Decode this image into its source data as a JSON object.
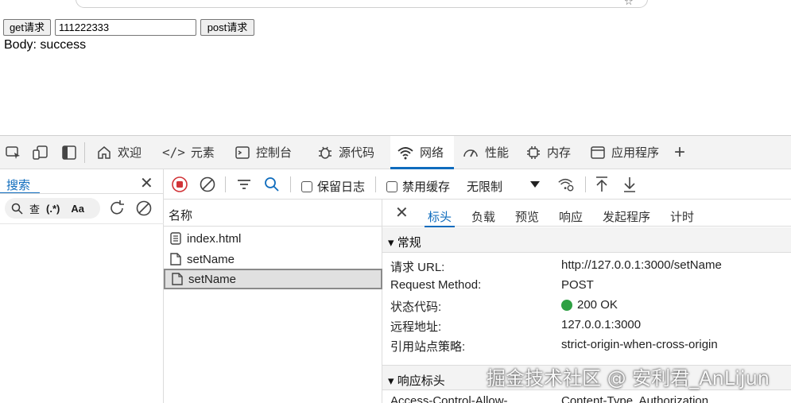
{
  "page": {
    "get_button": "get请求",
    "input_value": "111222333",
    "post_button": "post请求",
    "body_text": "Body: success"
  },
  "devtools": {
    "tabs": [
      {
        "label": "欢迎",
        "icon": "home-icon"
      },
      {
        "label": "元素",
        "icon": "code-icon"
      },
      {
        "label": "控制台",
        "icon": "console-icon"
      },
      {
        "label": "源代码",
        "icon": "bug-icon"
      },
      {
        "label": "网络",
        "icon": "wifi-icon",
        "active": true
      },
      {
        "label": "性能",
        "icon": "gauge-icon"
      },
      {
        "label": "内存",
        "icon": "chip-icon"
      },
      {
        "label": "应用程序",
        "icon": "app-window-icon"
      }
    ],
    "add_tab": "+"
  },
  "search_panel": {
    "tab_label": "搜索",
    "case_label": "Aa",
    "regex_label": "(.*)",
    "preserve_label": "查"
  },
  "net_toolbar": {
    "preserve_log": "保留日志",
    "disable_cache": "禁用缓存",
    "throttle": "无限制"
  },
  "request_list": {
    "header": "名称",
    "rows": [
      {
        "name": "index.html",
        "icon": "document-lines-icon"
      },
      {
        "name": "setName",
        "icon": "document-icon"
      },
      {
        "name": "setName",
        "icon": "document-icon",
        "selected": true
      }
    ]
  },
  "details": {
    "tabs": [
      "标头",
      "负载",
      "预览",
      "响应",
      "发起程序",
      "计时"
    ],
    "active_tab": "标头",
    "general_title": "▾ 常规",
    "general": [
      {
        "key": "请求 URL:",
        "value": "http://127.0.0.1:3000/setName"
      },
      {
        "key": "Request Method:",
        "value": "POST"
      },
      {
        "key": "状态代码:",
        "value": "200 OK",
        "status_color": "#2ea043"
      },
      {
        "key": "远程地址:",
        "value": "127.0.0.1:3000"
      },
      {
        "key": "引用站点策略:",
        "value": "strict-origin-when-cross-origin"
      }
    ],
    "response_title": "▾ 响应标头",
    "partial_row": {
      "key": "Access-Control-Allow-",
      "value": "Content-Type, Authorization"
    }
  },
  "watermark": "掘金技术社区 @ 安利君_AnLijun",
  "colors": {
    "accent": "#0f6cbd",
    "record": "#d13438",
    "status_ok": "#2ea043"
  }
}
